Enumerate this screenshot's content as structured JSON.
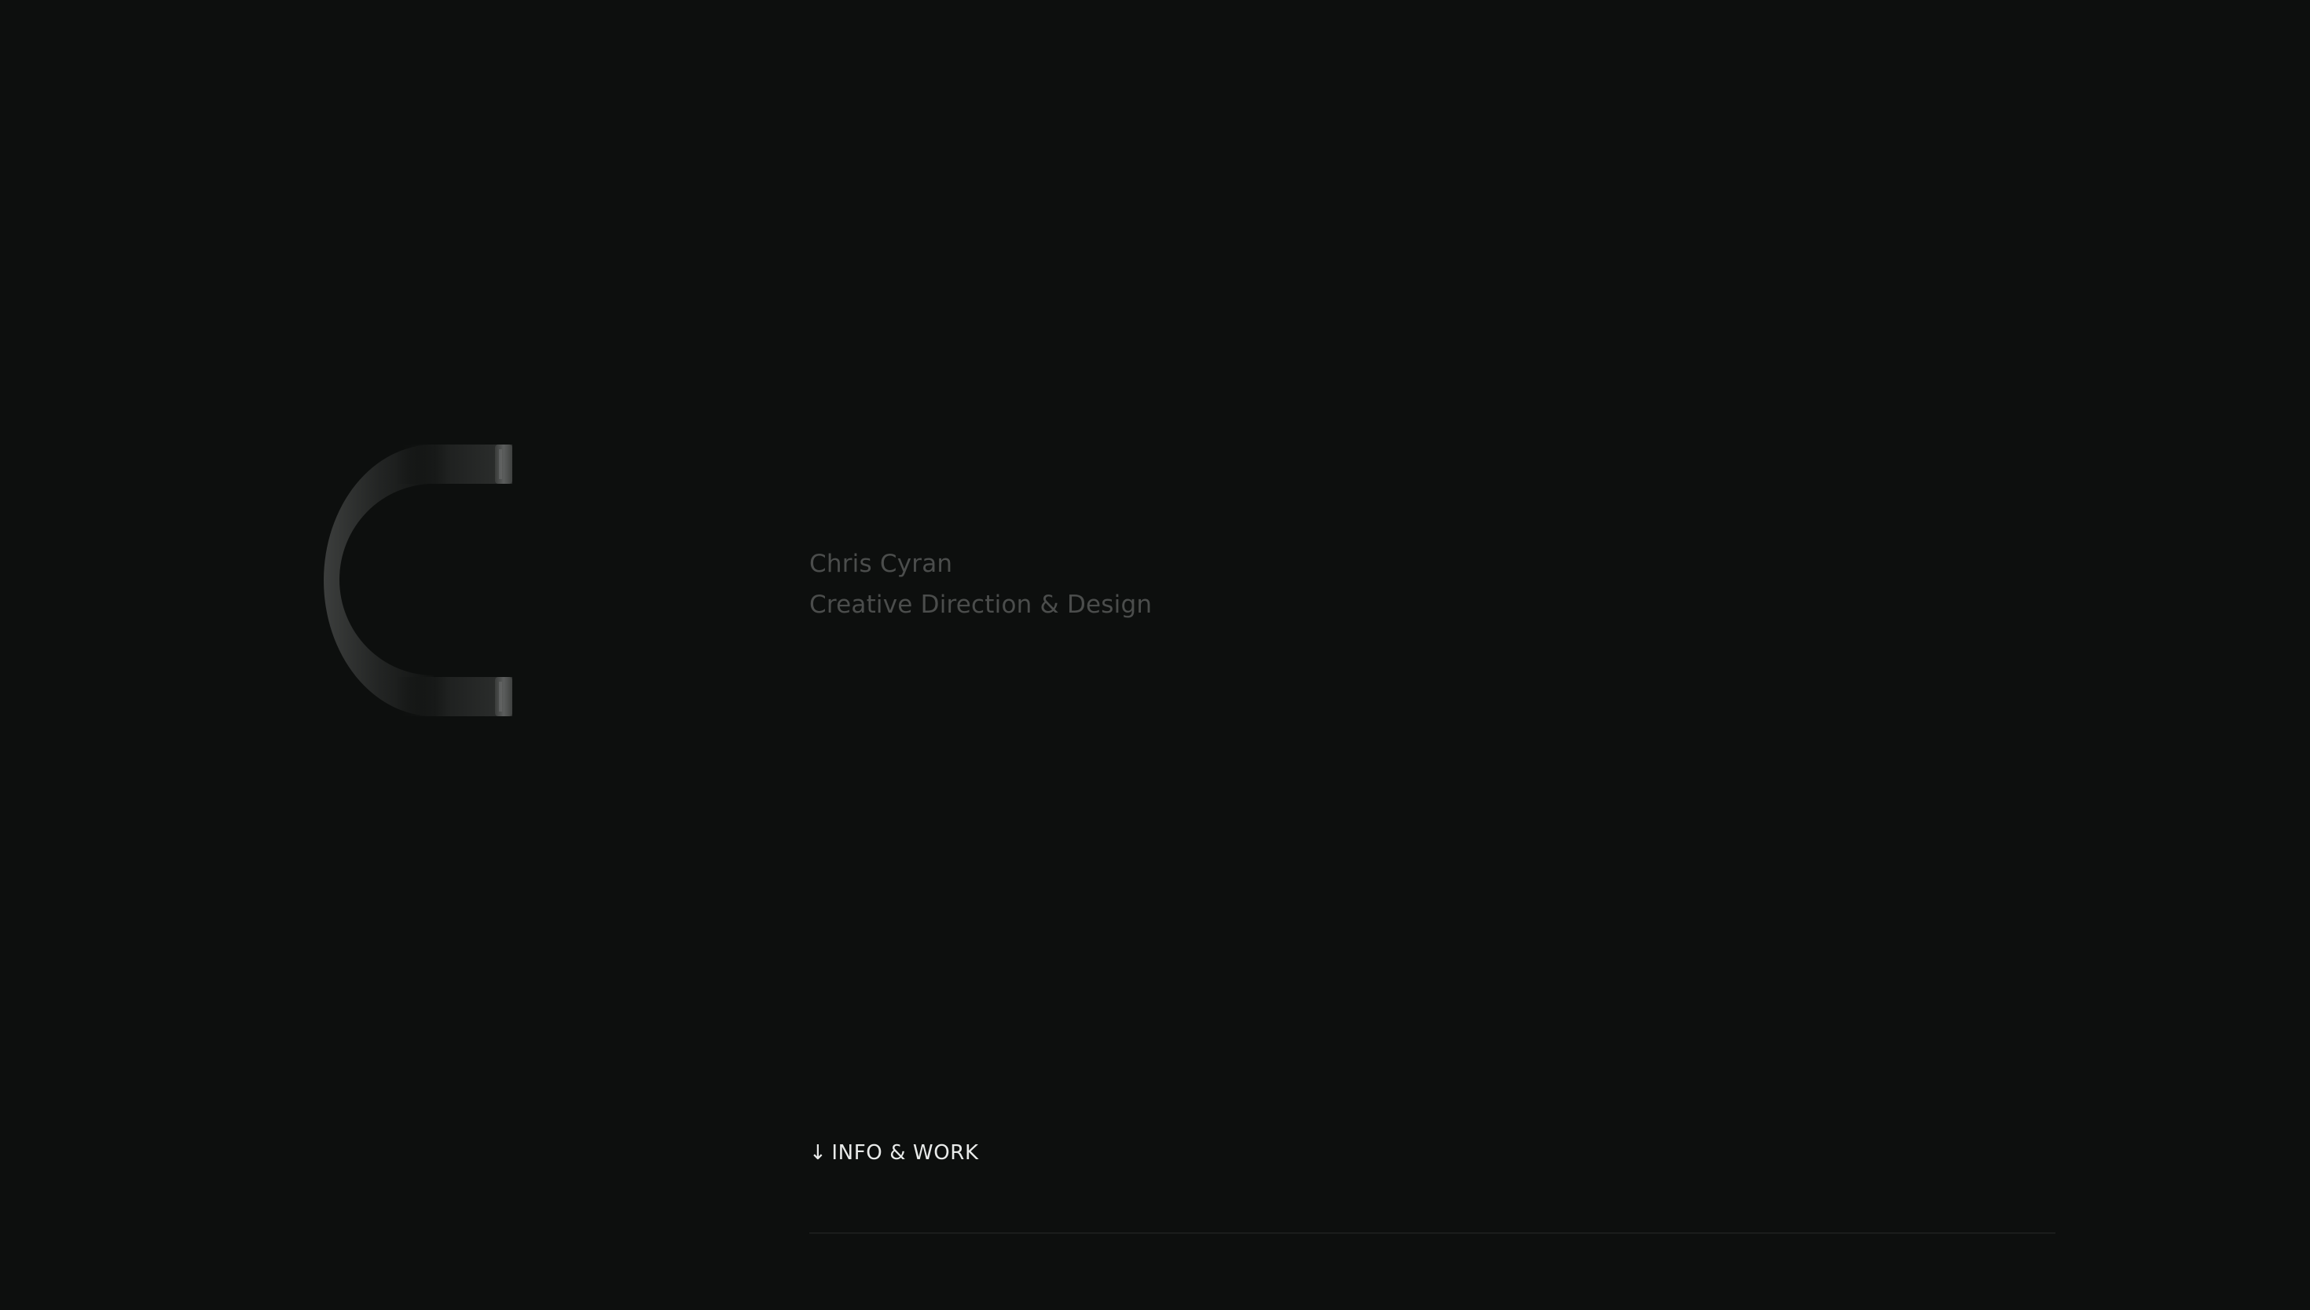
{
  "hero": {
    "logo_icon": "c-monogram-icon",
    "name": "Chris Cyran",
    "tagline": "Creative Direction & Design"
  },
  "nav": {
    "scroll_arrow": "↓",
    "scroll_label": "INFO & WORK"
  },
  "colors": {
    "background": "#0d0f0e",
    "muted_text": "#4b4d4c",
    "cta_text": "#e9ebea",
    "divider": "#1b1d1c"
  }
}
